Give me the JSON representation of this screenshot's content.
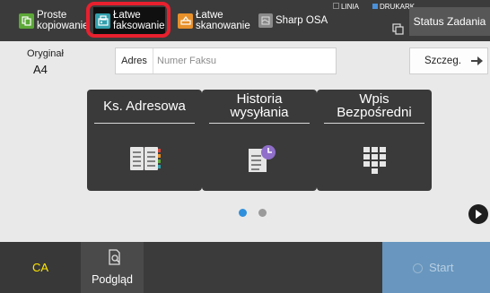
{
  "topbar": {
    "modes": [
      {
        "label": "Proste\nkopiowanie",
        "icon": "copy-icon",
        "color": "#5da838"
      },
      {
        "label": "Łatwe\nfaksowanie",
        "icon": "fax-icon",
        "color": "#33a0ad",
        "selected": true
      },
      {
        "label": "Łatwe\nskanowanie",
        "icon": "scan-icon",
        "color": "#e8912b"
      },
      {
        "label": "Sharp OSA",
        "icon": "osa-icon",
        "color": "#8a8a8a"
      }
    ],
    "line_status": "LINIA",
    "printer_status": "DRUKARK",
    "job_status_label": "Status Zadania"
  },
  "original": {
    "label": "Oryginał",
    "value": "A4"
  },
  "address": {
    "label": "Adres",
    "placeholder": "Numer Faksu"
  },
  "details_label": "Szczeg.",
  "tiles": [
    {
      "label": "Ks. Adresowa",
      "icon": "address-book-icon"
    },
    {
      "label": "Historia\nwysyłania",
      "icon": "send-history-icon"
    },
    {
      "label": "Wpis\nBezpośredni",
      "icon": "keypad-icon"
    }
  ],
  "pager": {
    "pages": 2,
    "current": 1
  },
  "bottombar": {
    "ca_label": "CA",
    "preview_label": "Podgląd",
    "start_label": "Start"
  },
  "colors": {
    "highlight": "#e8202e",
    "start_button": "#6896be",
    "ca_text": "#ffe600",
    "active_dot": "#2f8fdc"
  }
}
